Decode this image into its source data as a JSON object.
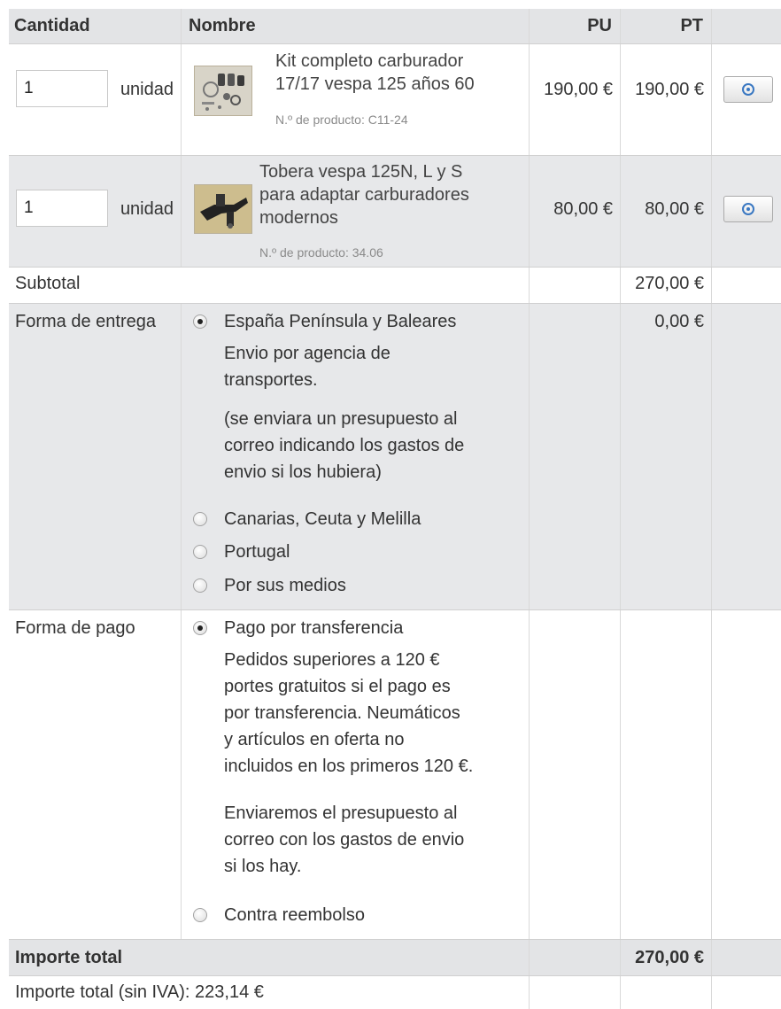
{
  "header": {
    "qty": "Cantidad",
    "name": "Nombre",
    "pu": "PU",
    "pt": "PT"
  },
  "items": [
    {
      "qty": "1",
      "unit": "unidad",
      "name_lines": [
        "Kit completo carburador",
        "17/17 vespa 125 años 60"
      ],
      "sku": "N.º de producto: C11-24",
      "pu": "190,00 €",
      "pt": "190,00 €",
      "thumb_icon": "carburetor-kit-thumbnail"
    },
    {
      "qty": "1",
      "unit": "unidad",
      "name_lines": [
        "Tobera vespa 125N, L y S",
        "para adaptar carburadores",
        "modernos"
      ],
      "sku": "N.º de producto: 34.06",
      "pu": "80,00 €",
      "pt": "80,00 €",
      "thumb_icon": "nozzle-thumbnail"
    }
  ],
  "subtotal": {
    "label": "Subtotal",
    "value": "270,00 €"
  },
  "delivery": {
    "label": "Forma de entrega",
    "value": "0,00 €",
    "selected": "España Península y Baleares",
    "selected_desc_1": [
      "Envio por agencia de",
      "transportes."
    ],
    "selected_desc_2": [
      "(se enviara un presupuesto al",
      "correo indicando los gastos de",
      "envio si los hubiera)"
    ],
    "options": [
      "Canarias, Ceuta y Melilla",
      "Portugal",
      "Por sus medios"
    ]
  },
  "payment": {
    "label": "Forma de pago",
    "selected": "Pago por transferencia",
    "selected_desc_1": [
      "Pedidos superiores a 120 €",
      "portes gratuitos si el pago es",
      "por transferencia. Neumáticos",
      "y artículos en oferta no",
      "incluidos en los primeros 120 €."
    ],
    "selected_desc_2": [
      "Enviaremos el presupuesto al",
      "correo con los gastos de envio",
      "si los hay."
    ],
    "options": [
      "Contra reembolso"
    ]
  },
  "total": {
    "label": "Importe total",
    "value": "270,00 €"
  },
  "net_total": {
    "label": "Importe total (sin IVA): 223,14 €"
  },
  "icons": {
    "delete": "trash-icon",
    "radio": "radio-button"
  }
}
